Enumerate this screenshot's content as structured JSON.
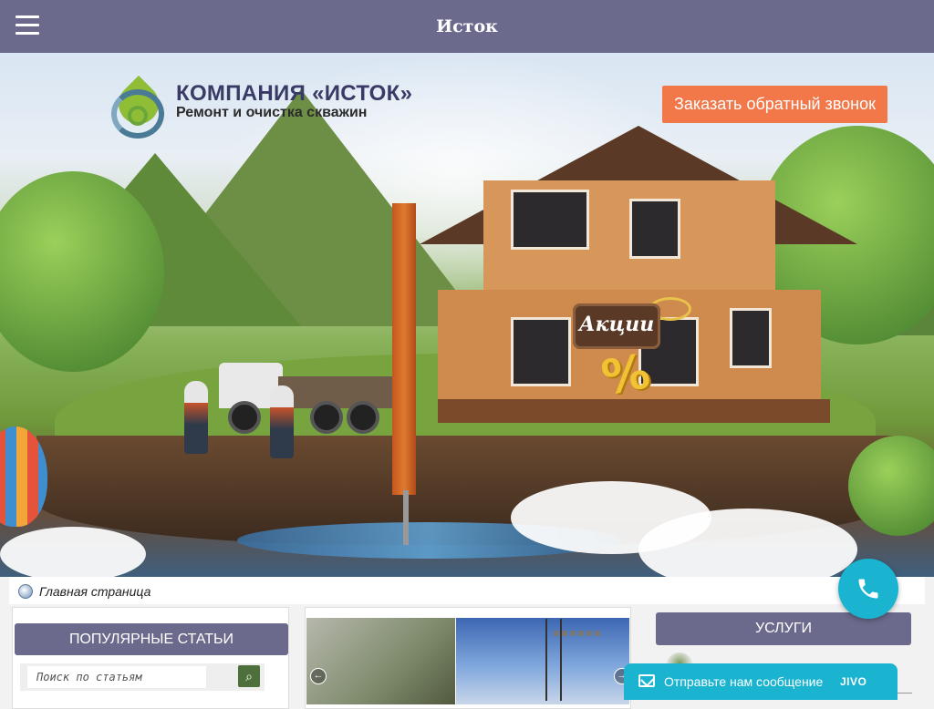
{
  "header": {
    "title": "Исток"
  },
  "hero": {
    "company_name": "КОМПАНИЯ «ИСТОК»",
    "tagline": "Ремонт и очистка скважин",
    "callback_button": "Заказать обратный звонок",
    "promo_label": "Акции",
    "promo_symbol": "%"
  },
  "breadcrumb": {
    "label": "Главная страница"
  },
  "sidebar_left": {
    "title": "ПОПУЛЯРНЫЕ СТАТЬИ",
    "search_placeholder": "Поиск по статьям",
    "search_button_icon": "⌕"
  },
  "slider": {
    "prev": "←",
    "next": "→"
  },
  "sidebar_right": {
    "title": "УСЛУГИ"
  },
  "chat": {
    "label": "Отправьте нам сообщение",
    "brand": "JIVO"
  },
  "colors": {
    "header_bg": "#6b6a8c",
    "accent_orange": "#f2784a",
    "chat_teal": "#1ab4d0"
  },
  "icons": {
    "menu": "hamburger-menu-icon",
    "breadcrumb": "globe-icon",
    "phone": "phone-icon",
    "chat": "envelope-icon"
  }
}
